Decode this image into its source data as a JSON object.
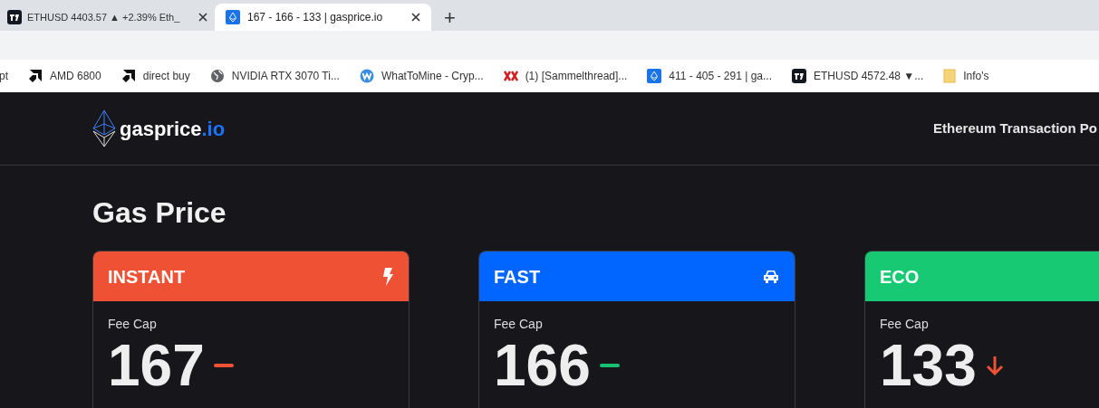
{
  "browser": {
    "tabs": [
      {
        "title": "ETHUSD 4403.57 ▲ +2.39% Eth_",
        "selected": false
      },
      {
        "title": "167 - 166 - 133 | gasprice.io",
        "selected": true
      }
    ],
    "new_tab": "+",
    "bookmarks": [
      {
        "label": "pt"
      },
      {
        "label": "AMD 6800"
      },
      {
        "label": "direct buy"
      },
      {
        "label": "NVIDIA RTX 3070 Ti..."
      },
      {
        "label": "WhatToMine - Cryp..."
      },
      {
        "label": "(1) [Sammelthread]..."
      },
      {
        "label": "411 - 405 - 291 | ga..."
      },
      {
        "label": "ETHUSD 4572.48 ▼..."
      },
      {
        "label": "Info's"
      }
    ]
  },
  "site": {
    "logo": {
      "name": "gasprice",
      "tld": ".io"
    },
    "nav": "Ethereum Transaction Po",
    "heading": "Gas Price",
    "cards": [
      {
        "title": "INSTANT",
        "color": "#ee5134",
        "label": "Fee Cap",
        "value": "167",
        "trend": {
          "kind": "flat",
          "color": "#ee5134"
        }
      },
      {
        "title": "FAST",
        "color": "#0066ff",
        "label": "Fee Cap",
        "value": "166",
        "trend": {
          "kind": "flat",
          "color": "#16c172"
        }
      },
      {
        "title": "ECO",
        "color": "#16c972",
        "label": "Fee Cap",
        "value": "133",
        "trend": {
          "kind": "down",
          "color": "#ee5134"
        }
      }
    ]
  }
}
